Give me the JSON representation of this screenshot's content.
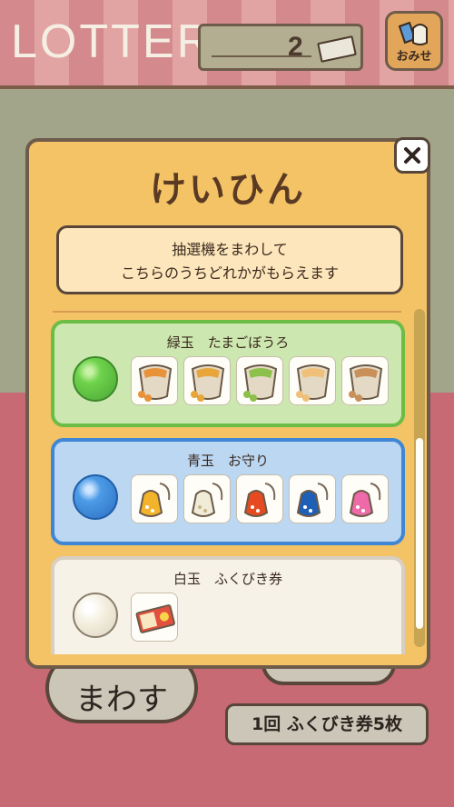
{
  "header": {
    "title": "LOTTERY",
    "ticket_count": "2",
    "shop_button_label": "おみせ"
  },
  "modal": {
    "title": "けいひん",
    "description_line1": "抽選機をまわして",
    "description_line2": "こちらのうちどれかがもらえます",
    "close_icon": "close-icon",
    "prizes": [
      {
        "name": "緑玉　たまごぼうろ",
        "ball_color": "#6fd34c",
        "item_icon": "cookie-bag-icon",
        "item_colors": [
          "#e8923a",
          "#e8a53a",
          "#8cc04a",
          "#f0c07a",
          "#c9905a"
        ]
      },
      {
        "name": "青玉　お守り",
        "ball_color": "#4d9be6",
        "item_icon": "omamori-charm-icon",
        "item_colors": [
          "#f2b42a",
          "#f1ecd8",
          "#e64a21",
          "#1f5fb5",
          "#ee6aa8"
        ]
      },
      {
        "name": "白玉　ふくびき券",
        "ball_color": "#f4efdf",
        "item_icon": "lottery-ticket-icon",
        "item_colors": [
          "#e4503e"
        ]
      }
    ]
  },
  "footer": {
    "spin_button_label": "まわす",
    "cost_label": "1回 ふくびき券5枚"
  },
  "colors": {
    "modal_bg": "#f3c366",
    "awning_stripe": "#d48a8c",
    "floor": "#c76a73"
  }
}
